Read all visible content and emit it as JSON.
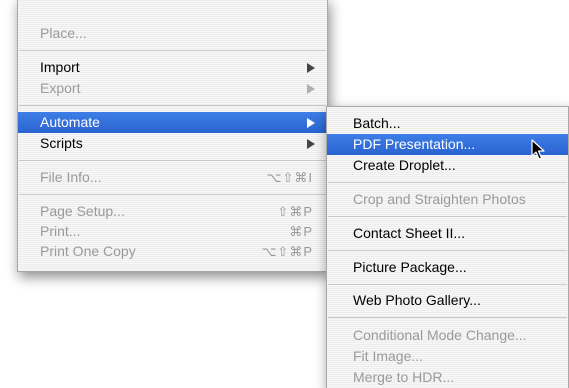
{
  "main_menu": {
    "items": [
      {
        "label": "Place...",
        "enabled": false
      },
      {
        "label": "Import",
        "enabled": true,
        "submenu": true
      },
      {
        "label": "Export",
        "enabled": false,
        "submenu": true
      },
      {
        "label": "Automate",
        "enabled": true,
        "submenu": true,
        "selected": true
      },
      {
        "label": "Scripts",
        "enabled": true,
        "submenu": true
      },
      {
        "label": "File Info...",
        "enabled": false,
        "shortcut": "⌥⇧⌘I"
      },
      {
        "label": "Page Setup...",
        "enabled": false,
        "shortcut": "⇧⌘P"
      },
      {
        "label": "Print...",
        "enabled": false,
        "shortcut": "⌘P"
      },
      {
        "label": "Print One Copy",
        "enabled": false,
        "shortcut": "⌥⇧⌘P"
      }
    ]
  },
  "automate_submenu": {
    "items": [
      {
        "label": "Batch...",
        "enabled": true
      },
      {
        "label": "PDF Presentation...",
        "enabled": true,
        "selected": true
      },
      {
        "label": "Create Droplet...",
        "enabled": true
      },
      {
        "label": "Crop and Straighten Photos",
        "enabled": false
      },
      {
        "label": "Contact Sheet II...",
        "enabled": true
      },
      {
        "label": "Picture Package...",
        "enabled": true
      },
      {
        "label": "Web Photo Gallery...",
        "enabled": true
      },
      {
        "label": "Conditional Mode Change...",
        "enabled": false
      },
      {
        "label": "Fit Image...",
        "enabled": false
      },
      {
        "label": "Merge to HDR...",
        "enabled": false
      }
    ]
  },
  "colors": {
    "selection": "#2f6fdc",
    "disabled_text": "#9a9a9a",
    "enabled_text": "#000000"
  },
  "icons": {
    "submenu_arrow": "triangle-right-icon",
    "pointer": "arrow-cursor-icon"
  }
}
